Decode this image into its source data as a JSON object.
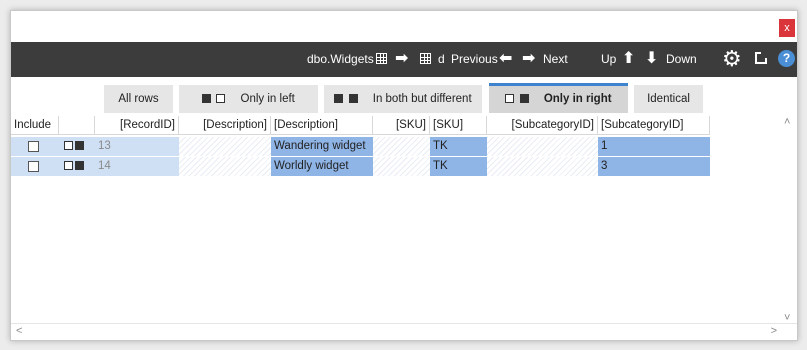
{
  "window": {
    "close_label": "x"
  },
  "toolbar": {
    "object_name": "dbo.Widgets",
    "target_suffix": "d",
    "previous_label": "Previous",
    "next_label": "Next",
    "up_label": "Up",
    "down_label": "Down",
    "help_label": "?"
  },
  "tabs": [
    {
      "label": "All rows",
      "active": false
    },
    {
      "label": "Only in left",
      "active": false
    },
    {
      "label": "In both but different",
      "active": false
    },
    {
      "label": "Only in right",
      "active": true
    },
    {
      "label": "Identical",
      "active": false
    }
  ],
  "grid": {
    "headers": [
      "Include",
      "",
      "[RecordID]",
      "[Description]",
      "[Description]",
      "[SKU]",
      "[SKU]",
      "[SubcategoryID]",
      "[SubcategoryID]"
    ],
    "rows": [
      {
        "include": false,
        "record_id": "13",
        "left_description": "",
        "right_description": "Wandering widget",
        "left_sku": "",
        "right_sku": "TK",
        "left_subcategory": "",
        "right_subcategory": "1"
      },
      {
        "include": false,
        "record_id": "14",
        "left_description": "",
        "right_description": "Worldly widget",
        "left_sku": "",
        "right_sku": "TK",
        "left_subcategory": "",
        "right_subcategory": "3"
      }
    ]
  },
  "colors": {
    "accent": "#3f83cf",
    "toolbar_bg": "#3c3c3c",
    "right_cell": "#8fb4e6",
    "row_highlight": "#cfe0f5",
    "close_button": "#d9353a"
  }
}
